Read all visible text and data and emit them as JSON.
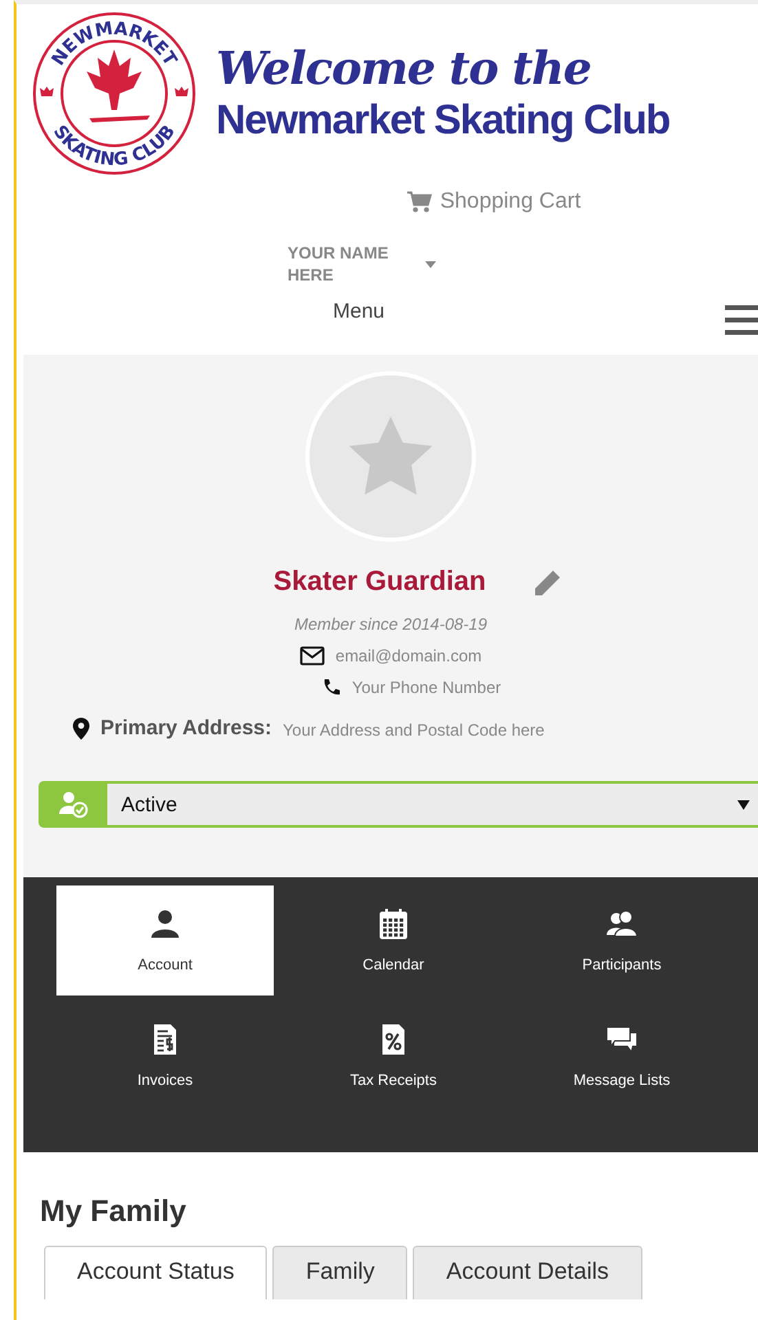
{
  "logo": {
    "top_text": "NEWMARKET",
    "bottom_text": "SKATING CLUB"
  },
  "header": {
    "welcome": "Welcome to the",
    "club_name": "Newmarket Skating Club"
  },
  "cart": {
    "label": "Shopping Cart"
  },
  "user_menu": {
    "name": "YOUR NAME HERE"
  },
  "menu": {
    "label": "Menu"
  },
  "profile": {
    "name": "Skater Guardian",
    "member_since": "Member since 2014-08-19",
    "email": "email@domain.com",
    "phone": "Your Phone Number",
    "address_label": "Primary Address:",
    "address": "Your Address and Postal Code here"
  },
  "status_select": {
    "value": "Active"
  },
  "nav": [
    {
      "label": "Account",
      "kind": "person",
      "selected": true
    },
    {
      "label": "Calendar",
      "kind": "calendar",
      "selected": false
    },
    {
      "label": "Participants",
      "kind": "people",
      "selected": false
    },
    {
      "label": "Invoices",
      "kind": "invoice",
      "selected": false
    },
    {
      "label": "Tax Receipts",
      "kind": "receipt",
      "selected": false
    },
    {
      "label": "Message Lists",
      "kind": "chat",
      "selected": false
    }
  ],
  "section_title": "My Family",
  "tabs": [
    {
      "label": "Account Status",
      "selected": true
    },
    {
      "label": "Family",
      "selected": false
    },
    {
      "label": "Account Details",
      "selected": false
    }
  ]
}
